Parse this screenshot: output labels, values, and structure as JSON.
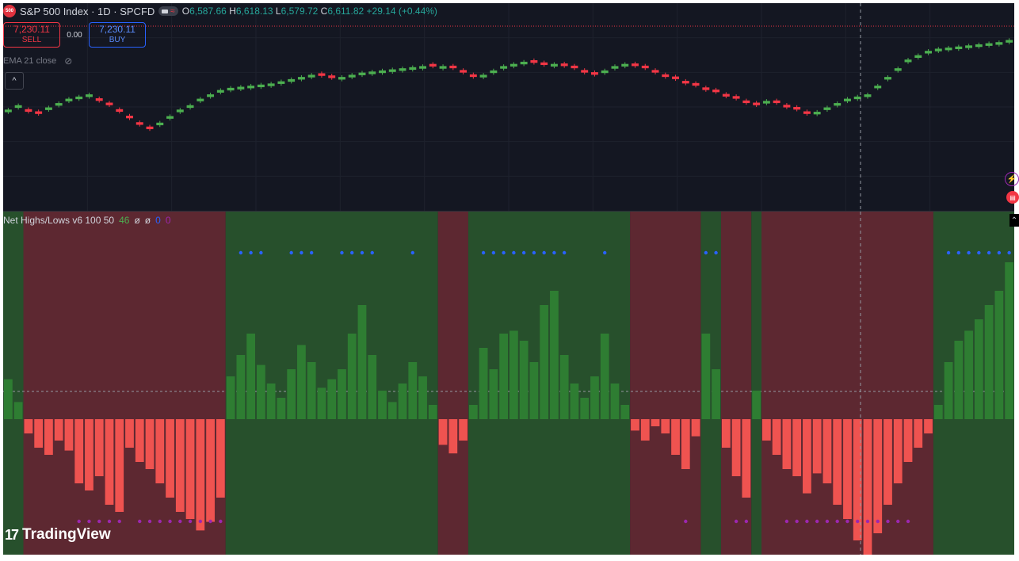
{
  "header": {
    "symbol_badge": "500",
    "title": "S&P 500 Index · 1D · SPCFD",
    "ohlc": {
      "o_label": "O",
      "o": "6,587.66",
      "h_label": "H",
      "h": "6,618.13",
      "l_label": "L",
      "l": "6,579.72",
      "c_label": "C",
      "c": "6,611.82",
      "change": "+29.14 (+0.44%)"
    }
  },
  "trade": {
    "sell_price": "7,230.11",
    "sell_label": "SELL",
    "spread": "0.00",
    "buy_price": "7,230.11",
    "buy_label": "BUY"
  },
  "ema_label": "EMA 21 close",
  "indicator": {
    "name": "Net Highs/Lows v6 100 50",
    "v1": "46",
    "v2": "ø",
    "v3": "ø",
    "v4": "0",
    "v5": "0"
  },
  "logo_text": "TradingView",
  "colors": {
    "bg": "#141722",
    "up": "#4caf50",
    "down": "#f23645",
    "bar_up": "#2e7d32",
    "bar_down": "#ef5350",
    "zone_green": "#2a5a2e",
    "zone_red": "#6a2c34",
    "dot_blue": "#2962ff",
    "dot_purple": "#9c27b0"
  },
  "icons": [
    "eye-off-icon",
    "chevron-up-icon",
    "bolt-icon",
    "flag-icon",
    "tradingview-logo-icon"
  ],
  "chart_data": {
    "type": "candlestick",
    "closes": [
      6450,
      6470,
      6440,
      6430,
      6460,
      6480,
      6500,
      6510,
      6520,
      6490,
      6470,
      6440,
      6410,
      6380,
      6360,
      6390,
      6420,
      6450,
      6470,
      6500,
      6520,
      6540,
      6550,
      6555,
      6560,
      6565,
      6570,
      6580,
      6590,
      6600,
      6610,
      6605,
      6595,
      6600,
      6610,
      6620,
      6625,
      6630,
      6635,
      6640,
      6645,
      6650,
      6648,
      6650,
      6640,
      6620,
      6600,
      6610,
      6630,
      6650,
      6660,
      6670,
      6665,
      6655,
      6660,
      6650,
      6640,
      6620,
      6610,
      6630,
      6650,
      6660,
      6650,
      6640,
      6620,
      6600,
      6590,
      6570,
      6560,
      6540,
      6530,
      6510,
      6500,
      6480,
      6470,
      6490,
      6480,
      6460,
      6450,
      6430,
      6440,
      6460,
      6480,
      6500,
      6510,
      6520,
      6560,
      6600,
      6640,
      6680,
      6700,
      6720,
      6730,
      6735,
      6740,
      6745,
      6750,
      6755,
      6760,
      6770
    ],
    "bull_bear": [
      "up",
      "up",
      "dn",
      "dn",
      "up",
      "up",
      "up",
      "up",
      "up",
      "dn",
      "dn",
      "dn",
      "dn",
      "dn",
      "dn",
      "up",
      "up",
      "up",
      "up",
      "up",
      "up",
      "up",
      "up",
      "up",
      "up",
      "up",
      "up",
      "up",
      "up",
      "up",
      "up",
      "dn",
      "dn",
      "up",
      "up",
      "up",
      "up",
      "up",
      "up",
      "up",
      "up",
      "up",
      "dn",
      "up",
      "dn",
      "dn",
      "dn",
      "up",
      "up",
      "up",
      "up",
      "up",
      "dn",
      "dn",
      "up",
      "dn",
      "dn",
      "dn",
      "dn",
      "up",
      "up",
      "up",
      "dn",
      "dn",
      "dn",
      "dn",
      "dn",
      "dn",
      "dn",
      "dn",
      "dn",
      "dn",
      "dn",
      "dn",
      "dn",
      "up",
      "dn",
      "dn",
      "dn",
      "dn",
      "up",
      "up",
      "up",
      "up",
      "up",
      "up",
      "up",
      "up",
      "up",
      "up",
      "up",
      "up",
      "up",
      "up",
      "up",
      "up",
      "up",
      "up",
      "up",
      "up"
    ],
    "net_highs_lows": [
      28,
      12,
      -10,
      -20,
      -25,
      -15,
      -22,
      -45,
      -50,
      -40,
      -60,
      -65,
      -20,
      -30,
      -35,
      -45,
      -55,
      -65,
      -70,
      -78,
      -72,
      -55,
      30,
      45,
      60,
      38,
      25,
      15,
      35,
      52,
      40,
      22,
      28,
      35,
      60,
      80,
      45,
      20,
      12,
      25,
      40,
      30,
      10,
      -18,
      -24,
      -15,
      10,
      50,
      35,
      60,
      62,
      55,
      40,
      80,
      90,
      45,
      25,
      15,
      30,
      60,
      25,
      10,
      -8,
      -15,
      -5,
      -10,
      -25,
      -35,
      -12,
      60,
      35,
      -20,
      -40,
      -55,
      20,
      -15,
      -25,
      -35,
      -40,
      -52,
      -38,
      -45,
      -60,
      -70,
      -85,
      -96,
      -80,
      -60,
      -45,
      -30,
      -20,
      -10,
      10,
      40,
      55,
      62,
      70,
      80,
      90,
      110
    ]
  }
}
